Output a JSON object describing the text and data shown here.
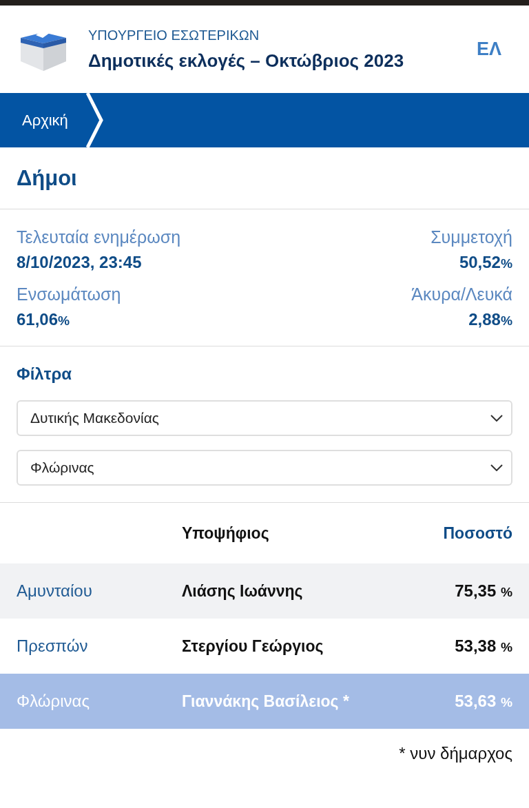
{
  "header": {
    "ministry": "ΥΠΟΥΡΓΕΙΟ ΕΣΩΤΕΡΙΚΩΝ",
    "title": "Δημοτικές εκλογές – Οκτώβριος 2023",
    "language": "ΕΛ"
  },
  "breadcrumbs": [
    "Αρχική"
  ],
  "page_title": "Δήμοι",
  "stats": [
    {
      "label": "Τελευταία ενημέρωση",
      "value": "8/10/2023, 23:45"
    },
    {
      "label": "Συμμετοχή",
      "value": "50,52",
      "unit": "%"
    },
    {
      "label": "Ενσωμάτωση",
      "value": "61,06",
      "unit": "%"
    },
    {
      "label": "Άκυρα/Λευκά",
      "value": "2,88",
      "unit": "%"
    }
  ],
  "filters": {
    "title": "Φίλτρα",
    "selects": [
      {
        "value": "Δυτικής Μακεδονίας"
      },
      {
        "value": "Φλώρινας"
      }
    ]
  },
  "table": {
    "columns": [
      "Υποψήφιος",
      "Ποσοστό"
    ],
    "rows": [
      {
        "municipality": "Αμυνταίου",
        "candidate": "Λιάσης Ιωάννης",
        "value": "75,35",
        "unit": "%",
        "selected": false
      },
      {
        "municipality": "Πρεσπών",
        "candidate": "Στεργίου Γεώργιος",
        "value": "53,38",
        "unit": "%",
        "selected": false
      },
      {
        "municipality": "Φλώρινας",
        "candidate": "Γιαννάκης Βασίλειος *",
        "value": "53,63",
        "unit": "%",
        "selected": true
      }
    ]
  },
  "footnote": "* νυν δήμαρχος"
}
